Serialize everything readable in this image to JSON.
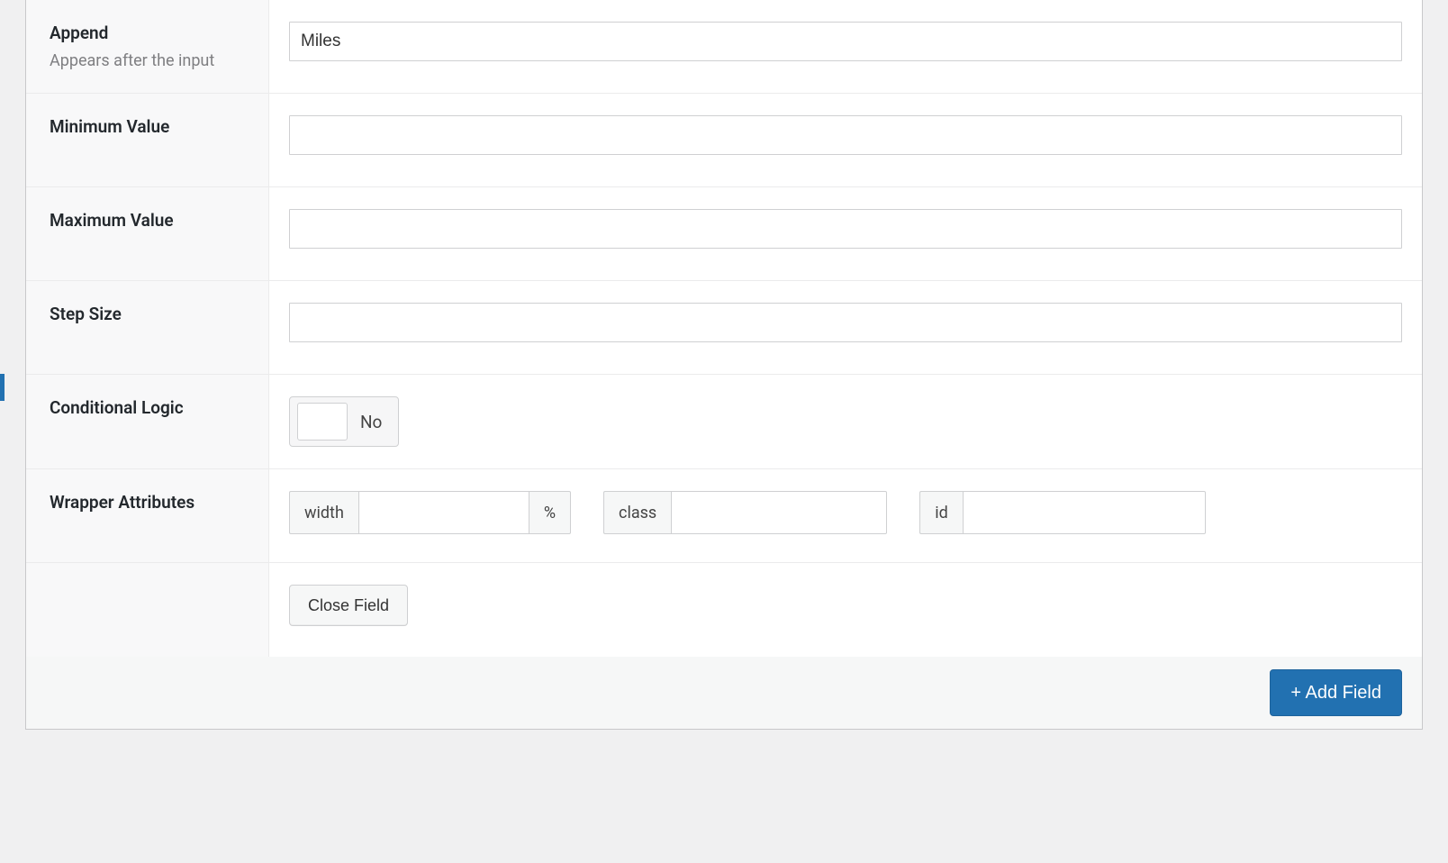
{
  "rows": {
    "append": {
      "label": "Append",
      "desc": "Appears after the input",
      "value": "Miles"
    },
    "min": {
      "label": "Minimum Value",
      "value": ""
    },
    "max": {
      "label": "Maximum Value",
      "value": ""
    },
    "step": {
      "label": "Step Size",
      "value": ""
    },
    "conditional": {
      "label": "Conditional Logic",
      "state_label": "No"
    },
    "wrapper": {
      "label": "Wrapper Attributes",
      "width_label": "width",
      "width_value": "",
      "width_unit": "%",
      "class_label": "class",
      "class_value": "",
      "id_label": "id",
      "id_value": ""
    }
  },
  "buttons": {
    "close_field": "Close Field",
    "add_field": "+ Add Field"
  }
}
